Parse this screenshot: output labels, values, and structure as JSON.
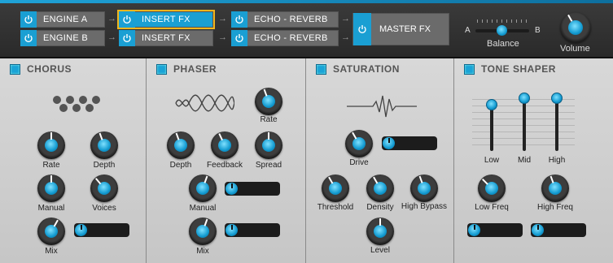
{
  "chain": {
    "engine_a": "ENGINE A",
    "engine_b": "ENGINE B",
    "insert_fx_a": "INSERT FX",
    "insert_fx_b": "INSERT FX",
    "echo_a": "ECHO - REVERB",
    "echo_b": "ECHO - REVERB",
    "master": "MASTER FX",
    "arrow": "→"
  },
  "balance": {
    "label": "Balance",
    "left": "A",
    "right": "B"
  },
  "volume": {
    "label": "Volume"
  },
  "panels": {
    "chorus": {
      "title": "CHORUS",
      "rate": "Rate",
      "depth": "Depth",
      "manual": "Manual",
      "voices": "Voices",
      "mix": "Mix"
    },
    "phaser": {
      "title": "PHASER",
      "rate": "Rate",
      "depth": "Depth",
      "feedback": "Feedback",
      "spread": "Spread",
      "manual": "Manual",
      "mix": "Mix"
    },
    "saturation": {
      "title": "SATURATION",
      "drive": "Drive",
      "threshold": "Threshold",
      "density": "Density",
      "high_bypass": "High Bypass",
      "level": "Level"
    },
    "tone": {
      "title": "TONE SHAPER",
      "low": "Low",
      "mid": "Mid",
      "high": "High",
      "low_freq": "Low Freq",
      "high_freq": "High Freq"
    }
  },
  "colors": {
    "accent": "#1a9fd3",
    "selected": "#f1b51c",
    "panel": "#d0d0d0"
  }
}
